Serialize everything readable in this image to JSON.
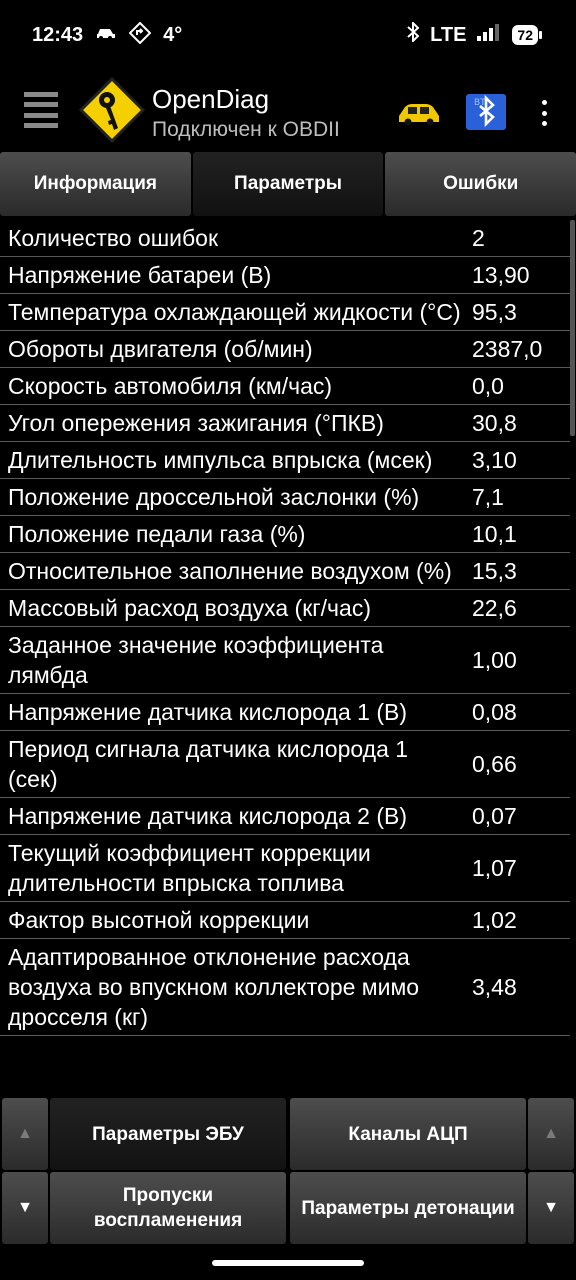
{
  "status_bar": {
    "time": "12:43",
    "temperature": "4°",
    "network": "LTE",
    "battery": "72"
  },
  "app_bar": {
    "title": "OpenDiag",
    "subtitle": "Подключен к OBDII",
    "bt_label": "BT"
  },
  "tabs": [
    {
      "label": "Информация"
    },
    {
      "label": "Параметры"
    },
    {
      "label": "Ошибки"
    }
  ],
  "parameters": [
    {
      "name": "Количество ошибок",
      "value": "2"
    },
    {
      "name": "Напряжение батареи (В)",
      "value": "13,90"
    },
    {
      "name": "Температура охлаждающей жидкости (°C)",
      "value": "95,3"
    },
    {
      "name": "Обороты двигателя (об/мин)",
      "value": "2387,0"
    },
    {
      "name": "Скорость автомобиля (км/час)",
      "value": "0,0"
    },
    {
      "name": "Угол опережения зажигания (°ПКВ)",
      "value": "30,8"
    },
    {
      "name": "Длительность импульса впрыска (мсек)",
      "value": "3,10"
    },
    {
      "name": "Положение дроссельной заслонки (%)",
      "value": "7,1"
    },
    {
      "name": "Положение педали газа (%)",
      "value": "10,1"
    },
    {
      "name": "Относительное заполнение воздухом (%)",
      "value": "15,3"
    },
    {
      "name": "Массовый расход воздуха (кг/час)",
      "value": "22,6"
    },
    {
      "name": "Заданное значение коэффициента лямбда",
      "value": "1,00"
    },
    {
      "name": "Напряжение датчика кислорода 1 (В)",
      "value": "0,08"
    },
    {
      "name": "Период сигнала датчика кислорода 1 (сек)",
      "value": "0,66"
    },
    {
      "name": "Напряжение датчика кислорода 2 (В)",
      "value": "0,07"
    },
    {
      "name": "Текущий коэффициент коррекции длительности впрыска топлива",
      "value": "1,07"
    },
    {
      "name": "Фактор высотной коррекции",
      "value": "1,02"
    },
    {
      "name": "Адаптированное отклонение расхода воздуха во впускном коллекторе мимо дросселя (кг)",
      "value": "3,48"
    }
  ],
  "bottom_buttons": {
    "ecu_params": "Параметры ЭБУ",
    "adc_channels": "Каналы АЦП",
    "misfires": "Пропуски воспламенения",
    "knock_params": "Параметры детонации",
    "arrow_up": "▲",
    "arrow_down": "▼"
  },
  "colors": {
    "background": "#000000",
    "logo_yellow": "#f5d000",
    "car_yellow": "#f0c800",
    "bluetooth_blue": "#2a60d8"
  }
}
